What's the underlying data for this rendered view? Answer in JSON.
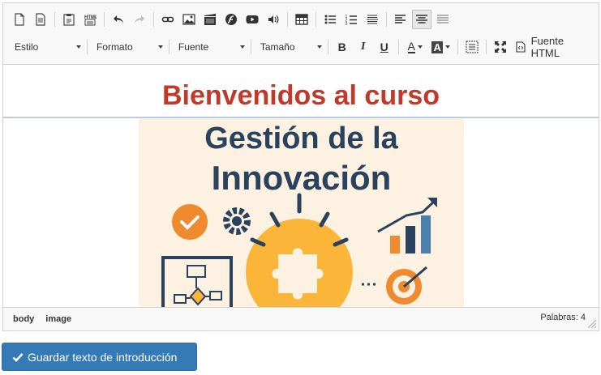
{
  "toolbar": {
    "row1_icons": [
      "new-page-icon",
      "templates-icon",
      "paste-text-icon",
      "paste-word-icon",
      "undo-icon",
      "redo-icon",
      "link-icon",
      "image-icon",
      "video-icon",
      "flash-icon",
      "youtube-icon",
      "audio-icon",
      "table-icon",
      "bulleted-list-icon",
      "numbered-list-icon",
      "horizontal-rule-icon",
      "align-left-icon",
      "align-center-icon",
      "align-justify-icon"
    ],
    "style_label": "Estilo",
    "format_label": "Formato",
    "font_label": "Fuente",
    "size_label": "Tamaño",
    "bold_label": "B",
    "italic_label": "I",
    "underline_label": "U",
    "font_color_label": "A",
    "bg_color_label": "A",
    "source_label": "Fuente HTML"
  },
  "content": {
    "heading": "Bienvenidos al curso",
    "image_title_line1": "Gestión de la",
    "image_title_line2": "Innovación"
  },
  "statusbar": {
    "path": [
      "body",
      "image"
    ],
    "word_count": "Palabras: 4"
  },
  "save_button": {
    "label": "Guardar texto de introducción"
  },
  "colors": {
    "heading": "#c0392b",
    "image_bg": "#fdf1e1",
    "image_title": "#29435e",
    "accent_orange": "#f5a43a",
    "save_button": "#337ab7"
  }
}
